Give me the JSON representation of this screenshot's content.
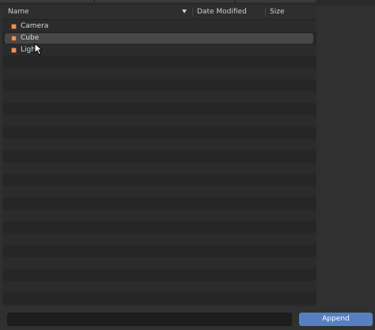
{
  "file_browser": {
    "columns": {
      "name": "Name",
      "date_modified": "Date Modified",
      "size": "Size"
    },
    "sort_icon": "chevron-down-icon",
    "items": [
      {
        "label": "Camera",
        "icon": "object-icon",
        "hovered": false
      },
      {
        "label": "Cube",
        "icon": "object-icon",
        "hovered": true
      },
      {
        "label": "Light",
        "icon": "object-icon",
        "hovered": false
      }
    ]
  },
  "footer": {
    "filename_value": "",
    "append_label": "Append"
  },
  "colors": {
    "accent": "#5680c2",
    "object_icon": "#e8935a"
  }
}
